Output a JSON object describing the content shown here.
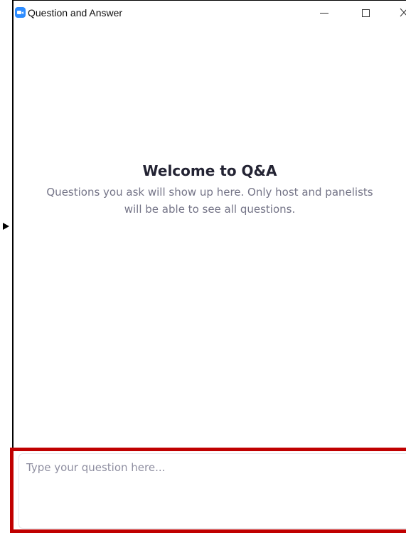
{
  "window": {
    "title": "Question and Answer",
    "icon": "zoom-camera-icon",
    "controls": {
      "minimize": "minimize-icon",
      "maximize": "maximize-icon",
      "close": "close-icon"
    }
  },
  "empty_state": {
    "title": "Welcome to Q&A",
    "description": "Questions you ask will show up here. Only host and panelists will be able to see all questions."
  },
  "question_input": {
    "value": "",
    "placeholder": "Type your question here..."
  },
  "colors": {
    "brand": "#2d8cff",
    "highlight": "#c00000",
    "heading": "#232333",
    "muted": "#747487"
  }
}
